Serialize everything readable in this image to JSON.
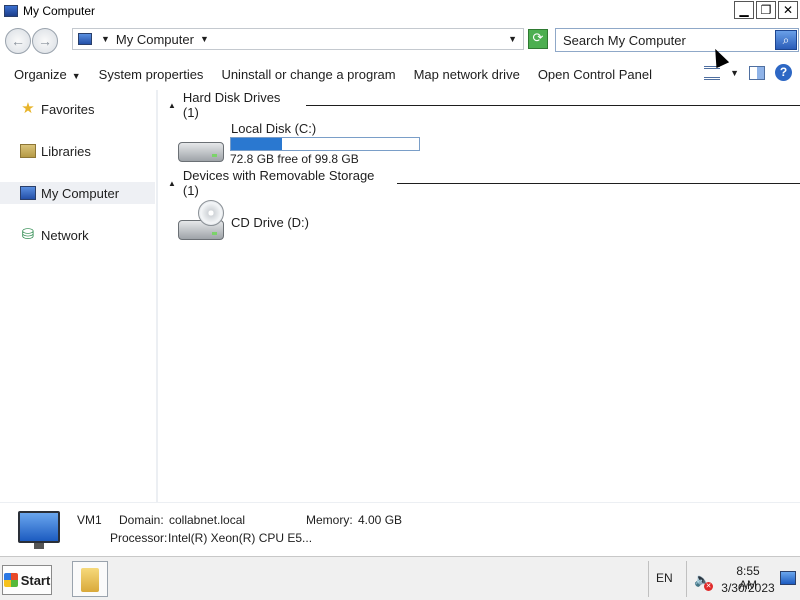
{
  "window": {
    "title": "My Computer",
    "minimize_glyph": "▁",
    "restore_glyph": "❐",
    "close_glyph": "✕"
  },
  "address": {
    "location": "My Computer",
    "search_placeholder": "Search My Computer"
  },
  "toolbar": {
    "organize": "Organize",
    "system_properties": "System properties",
    "uninstall": "Uninstall or change a program",
    "map_drive": "Map network drive",
    "control_panel": "Open Control Panel"
  },
  "sidebar": {
    "items": [
      {
        "label": "Favorites",
        "icon": "star-icon"
      },
      {
        "label": "Libraries",
        "icon": "libraries-icon"
      },
      {
        "label": "My Computer",
        "icon": "computer-icon",
        "selected": true
      },
      {
        "label": "Network",
        "icon": "network-icon"
      }
    ]
  },
  "groups": {
    "hdd_header": "Hard Disk Drives (1)",
    "removable_header": "Devices with Removable Storage (1)"
  },
  "drives": {
    "c": {
      "label": "Local Disk (C:)",
      "free_text": "72.8 GB free of 99.8 GB",
      "used_fraction": 0.27
    },
    "d": {
      "label": "CD Drive (D:)"
    }
  },
  "details": {
    "name": "VM1",
    "domain_label": "Domain:",
    "domain_value": "collabnet.local",
    "memory_label": "Memory:",
    "memory_value": "4.00 GB",
    "processor_label": "Processor:",
    "processor_value": "Intel(R) Xeon(R) CPU E5..."
  },
  "taskbar": {
    "start_label": "Start",
    "language": "EN",
    "time": "8:55 AM",
    "date": "3/30/2023"
  },
  "colors": {
    "usage_fill": "#2a78d0",
    "selected_bg": "#eef0f4"
  }
}
